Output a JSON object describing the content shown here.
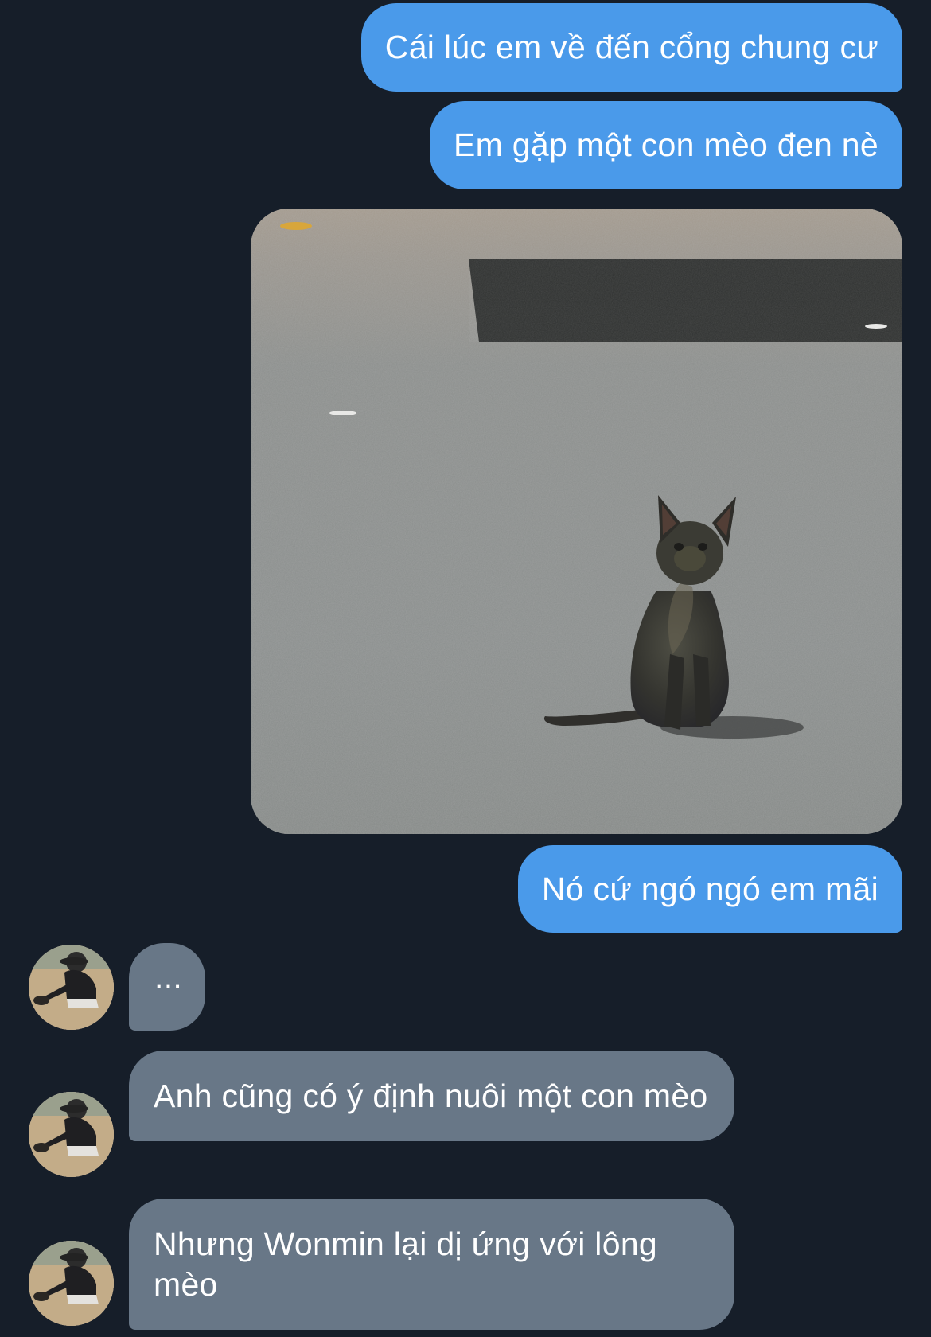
{
  "conversation": {
    "messages": [
      {
        "sender": "me",
        "type": "text",
        "text": "Cái lúc em về đến cổng chung cư"
      },
      {
        "sender": "me",
        "type": "text",
        "text": "Em gặp một con mèo đen nè"
      },
      {
        "sender": "me",
        "type": "image",
        "subject": "black cat sitting on asphalt"
      },
      {
        "sender": "me",
        "type": "text",
        "text": "Nó cứ ngó ngó em mãi"
      },
      {
        "sender": "other",
        "type": "text",
        "text": "..."
      },
      {
        "sender": "other",
        "type": "text",
        "text": "Anh cũng có ý định nuôi một con mèo"
      },
      {
        "sender": "other",
        "type": "text",
        "text": "Nhưng Wonmin lại dị ứng với lông mèo"
      }
    ]
  },
  "colors": {
    "background": "#161e29",
    "outgoing_bubble": "#4a9aea",
    "incoming_bubble": "#687787",
    "text": "#ffffff"
  }
}
